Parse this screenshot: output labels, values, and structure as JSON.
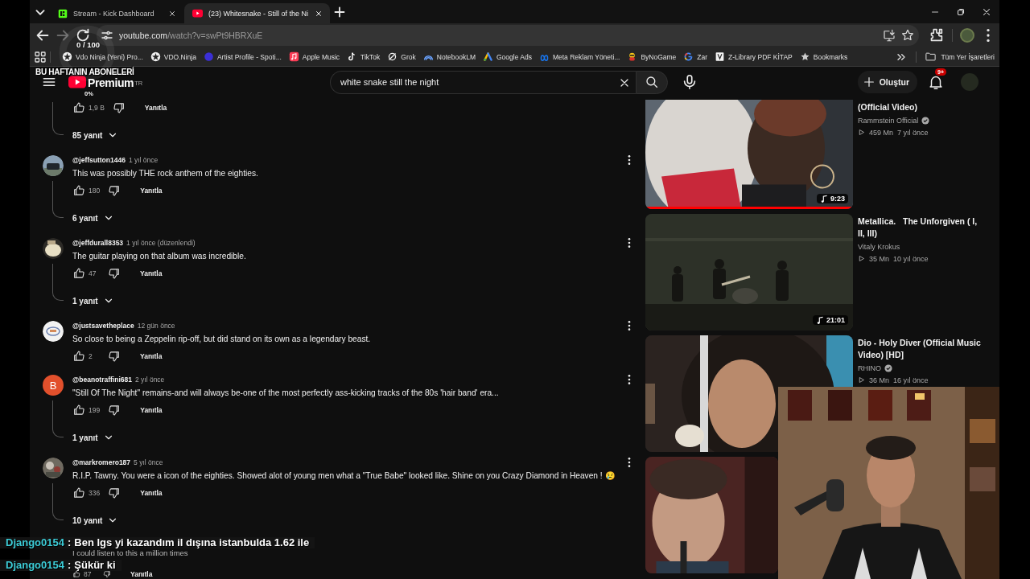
{
  "tabs": [
    {
      "title": "Stream - Kick Dashboard",
      "kind": "kick",
      "selected": false
    },
    {
      "title": "(23) Whitesnake - Still of the Ni",
      "kind": "youtube",
      "selected": true
    }
  ],
  "address": {
    "host": "youtube.com",
    "path": "/watch?v=swPt9HBRXuE"
  },
  "bookmarks": [
    {
      "label": "Vdo Ninja (Yeni) Pro...",
      "kind": "ninja"
    },
    {
      "label": "VDO.Ninja",
      "kind": "ninja"
    },
    {
      "label": "Artist Profile - Spoti...",
      "kind": "dot",
      "color": "#3b2fd6"
    },
    {
      "label": "Apple Music",
      "kind": "music"
    },
    {
      "label": "TikTok",
      "kind": "tiktok"
    },
    {
      "label": "Grok",
      "kind": "grok"
    },
    {
      "label": "NotebookLM",
      "kind": "notebook"
    },
    {
      "label": "Google Ads",
      "kind": "ads"
    },
    {
      "label": "Meta Reklam Yöneti...",
      "kind": "meta"
    },
    {
      "label": "ByNoGame",
      "kind": "game"
    },
    {
      "label": "Zar",
      "kind": "google"
    },
    {
      "label": "Z-Library PDF KİTAP",
      "kind": "zlib"
    },
    {
      "label": "Bookmarks",
      "kind": "star"
    }
  ],
  "bookmarks_folder": "Tüm Yer İşaretleri",
  "youtube": {
    "logo_text": "Premium",
    "region": "TR",
    "search_query": "white snake still the night",
    "create_label": "Oluştur",
    "notification_count": "9+"
  },
  "comments": [
    {
      "likes": "1,9 B",
      "reply_label": "Yanıtla",
      "replies": "85 yanıt"
    },
    {
      "avatar": {
        "kind": "picture"
      },
      "author": "@jeffsutton1446",
      "time": "1 yıl önce",
      "text": "This was possibly THE rock anthem of the eighties.",
      "likes": "180",
      "reply_label": "Yanıtla",
      "replies": "6 yanıt"
    },
    {
      "avatar": {
        "kind": "picture"
      },
      "author": "@jeffdurall8353",
      "time": "1 yıl önce (düzenlendi)",
      "text": "The guitar playing on that album was incredible.",
      "likes": "47",
      "reply_label": "Yanıtla",
      "replies": "1 yanıt"
    },
    {
      "avatar": {
        "kind": "picture"
      },
      "author": "@justsavetheplace",
      "time": "12 gün önce",
      "text": "So close to being a Zeppelin rip-off, but did stand on its own as a legendary beast.",
      "likes": "2",
      "reply_label": "Yanıtla"
    },
    {
      "avatar": {
        "kind": "letter",
        "letter": "B",
        "color": "#e2502c"
      },
      "author": "@beanotraffini681",
      "time": "2 yıl önce",
      "text": "\"Still Of The Night\" remains-and will always be-one of the most perfectly ass-kicking tracks of the 80s 'hair band' era...",
      "likes": "199",
      "reply_label": "Yanıtla",
      "replies": "1 yanıt"
    },
    {
      "avatar": {
        "kind": "picture"
      },
      "author": "@markromero187",
      "time": "5 yıl önce",
      "text": "R.I.P. Tawny. You were a icon of the eighties. Showed alot of young men what a \"True Babe\" looked like. Shine on you Crazy Diamond in Heaven ! 😢",
      "likes": "336",
      "reply_label": "Yanıtla",
      "replies": "10 yanıt"
    },
    {
      "text": "I could listen to this a million times",
      "likes": "87",
      "reply_label": "Yanıtla"
    }
  ],
  "videos": [
    {
      "title": "(Official Video)",
      "channel": "Rammstein Official",
      "verified": true,
      "views": "459 Mn",
      "age": "7 yıl önce",
      "duration": "9:23",
      "level": 1
    },
    {
      "title": "Metallica.   The Unforgiven ( I, II, III)",
      "channel": "Vitaly Krokus",
      "verified": false,
      "views": "35 Mn",
      "age": "10 yıl önce",
      "duration": "21:01"
    },
    {
      "title": "Dio - Holy Diver (Official Music Video) [HD]",
      "channel": "RHINO",
      "verified": true,
      "views": "36 Mn",
      "age": "16 yıl önce"
    },
    {
      "kind": "picture"
    }
  ],
  "goal": {
    "title": "BU HAFTANIN ABONELERİ",
    "count": "0 / 100",
    "percent": "0%"
  },
  "chat": [
    {
      "user": "Django0154",
      "separator": ":",
      "text": "Ben lgs yi kazandım il dışına istanbulda 1.62 ile"
    },
    {
      "user": "Django0154",
      "separator": ":",
      "text": "Şükür ki"
    }
  ],
  "webcam": {
    "kind": "picture"
  }
}
